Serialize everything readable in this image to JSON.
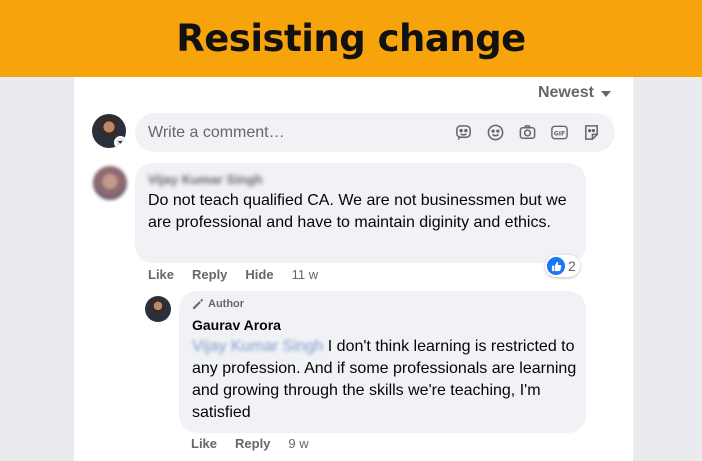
{
  "banner": {
    "title": "Resisting change"
  },
  "sort": {
    "label": "Newest"
  },
  "composer": {
    "placeholder": "Write a comment…",
    "icons": [
      "sticker-icon",
      "emoji-icon",
      "camera-icon",
      "gif-icon",
      "avatar-sticker-icon"
    ]
  },
  "comment": {
    "author": "Vijay Kumar Singh",
    "text": "Do not teach qualified CA. We are not businessmen but we are professional and have to maintain diginity and ethics.",
    "actions": {
      "like": "Like",
      "reply": "Reply",
      "hide": "Hide"
    },
    "time": "11 w",
    "reaction_count": "2"
  },
  "reply": {
    "badge": "Author",
    "author": "Gaurav Arora",
    "mention": "Vijay Kumar Singh",
    "text": "I don't think learning is restricted to any profession. And if some professionals are learning and growing through the skills we're teaching, I'm satisfied",
    "actions": {
      "like": "Like",
      "reply": "Reply"
    },
    "time": "9 w"
  },
  "colors": {
    "banner": "#f7a30c",
    "like": "#1877f2",
    "bubble": "#f0f2f5",
    "muted": "#65676b"
  }
}
